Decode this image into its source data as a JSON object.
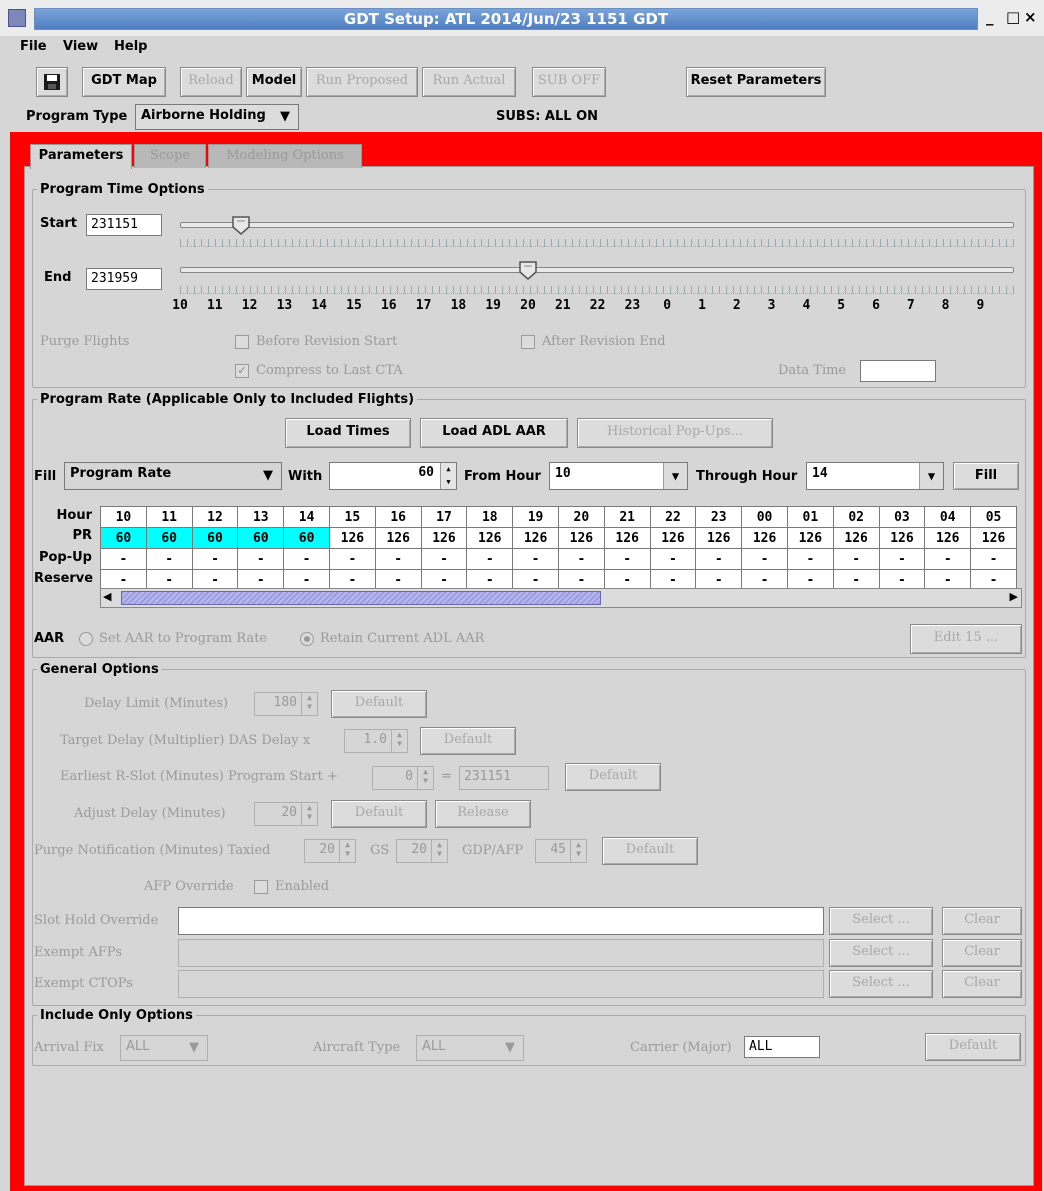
{
  "window": {
    "title": "GDT Setup: ATL 2014/Jun/23 1151 GDT",
    "controls": [
      "_",
      "□",
      "×"
    ]
  },
  "menu": [
    "File",
    "View",
    "Help"
  ],
  "toolbar": {
    "gdt_map": "GDT Map",
    "reload": "Reload",
    "model": "Model",
    "run_proposed": "Run Proposed",
    "run_actual": "Run Actual",
    "sub_off": "SUB OFF",
    "reset_parameters": "Reset Parameters"
  },
  "program_type": {
    "label": "Program Type",
    "value": "Airborne Holding"
  },
  "subs_status": "SUBS: ALL ON",
  "tabs": [
    "Parameters",
    "Scope",
    "Modeling Options"
  ],
  "time_options": {
    "legend": "Program Time Options",
    "start_label": "Start",
    "start_value": "231151",
    "end_label": "End",
    "end_value": "231959",
    "hours": [
      "10",
      "11",
      "12",
      "13",
      "14",
      "15",
      "16",
      "17",
      "18",
      "19",
      "20",
      "21",
      "22",
      "23",
      "0",
      "1",
      "2",
      "3",
      "4",
      "5",
      "6",
      "7",
      "8",
      "9"
    ],
    "purge_flights": "Purge Flights",
    "before_revision_start": "Before Revision Start",
    "after_revision_end": "After Revision End",
    "compress_to_last_cta": "Compress to Last CTA",
    "data_time": "Data Time"
  },
  "program_rate": {
    "legend": "Program Rate (Applicable Only to Included Flights)",
    "load_times": "Load Times",
    "load_adl_aar": "Load ADL AAR",
    "historical_popups": "Historical Pop-Ups...",
    "fill_label": "Fill",
    "fill_value": "Program Rate",
    "with_label": "With",
    "with_value": "60",
    "from_hour_label": "From Hour",
    "from_hour_value": "10",
    "through_hour_label": "Through Hour",
    "through_hour_value": "14",
    "fill_button": "Fill",
    "row_labels": {
      "hour": "Hour",
      "pr": "PR",
      "popup": "Pop-Up",
      "reserve": "Reserve"
    },
    "grid_hours": [
      "10",
      "11",
      "12",
      "13",
      "14",
      "15",
      "16",
      "17",
      "18",
      "19",
      "20",
      "21",
      "22",
      "23",
      "00",
      "01",
      "02",
      "03",
      "04",
      "05"
    ],
    "grid_pr": [
      "60",
      "60",
      "60",
      "60",
      "60",
      "126",
      "126",
      "126",
      "126",
      "126",
      "126",
      "126",
      "126",
      "126",
      "126",
      "126",
      "126",
      "126",
      "126",
      "126"
    ],
    "highlight_count": 5,
    "aar_label": "AAR",
    "set_aar": "Set AAR to Program Rate",
    "retain_aar": "Retain Current ADL AAR",
    "edit_15": "Edit 15 ..."
  },
  "general_options": {
    "legend": "General Options",
    "delay_limit": "Delay Limit (Minutes)",
    "delay_limit_value": "180",
    "target_delay": "Target Delay (Multiplier) DAS Delay x",
    "target_delay_value": "1.0",
    "earliest_rslot": "Earliest R-Slot (Minutes) Program Start +",
    "earliest_value": "0",
    "equals": "=",
    "earliest_result": "231151",
    "adjust_delay": "Adjust Delay (Minutes)",
    "adjust_delay_value": "20",
    "release": "Release",
    "purge_notification": "Purge Notification (Minutes) Taxied",
    "taxied_value": "20",
    "gs_label": "GS",
    "gs_value": "20",
    "gdp_afp_label": "GDP/AFP",
    "gdp_afp_value": "45",
    "afp_override": "AFP Override",
    "enabled": "Enabled",
    "default": "Default",
    "slot_hold_override": "Slot Hold Override",
    "exempt_afps": "Exempt AFPs",
    "exempt_ctops": "Exempt CTOPs",
    "select": "Select ...",
    "clear": "Clear"
  },
  "include_only": {
    "legend": "Include Only Options",
    "arrival_fix": "Arrival Fix",
    "arrival_fix_value": "ALL",
    "aircraft_type": "Aircraft Type",
    "aircraft_type_value": "ALL",
    "carrier": "Carrier (Major)",
    "carrier_value": "ALL",
    "default": "Default"
  },
  "colors": {
    "frame": "#ff0000",
    "highlight": "#00ffff",
    "title_blue": "#5a88c8"
  }
}
